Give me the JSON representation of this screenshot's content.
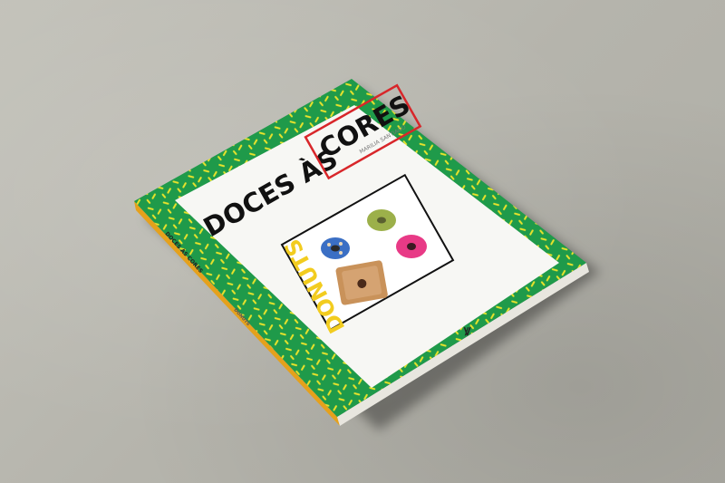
{
  "book": {
    "title_part1": "DOCES ÀS",
    "title_part2": "CORES",
    "author": "MARILIA SANTIAGO",
    "subtitle": "DONUTS",
    "spine_title": "DOCES ÀS CORES",
    "spine_subtitle": "DONUTS",
    "publisher_logo_icon": "publisher-logo-icon"
  },
  "colors": {
    "cover_green": "#1f9a4a",
    "pattern_yellow": "#e9e32b",
    "title_box_red": "#d8262a",
    "subtitle_yellow": "#f2cc1f",
    "donut_blue": "#3b6fc4",
    "donut_green": "#9cb04a",
    "donut_pink": "#e83a86",
    "donut_square": "#c9925a"
  }
}
